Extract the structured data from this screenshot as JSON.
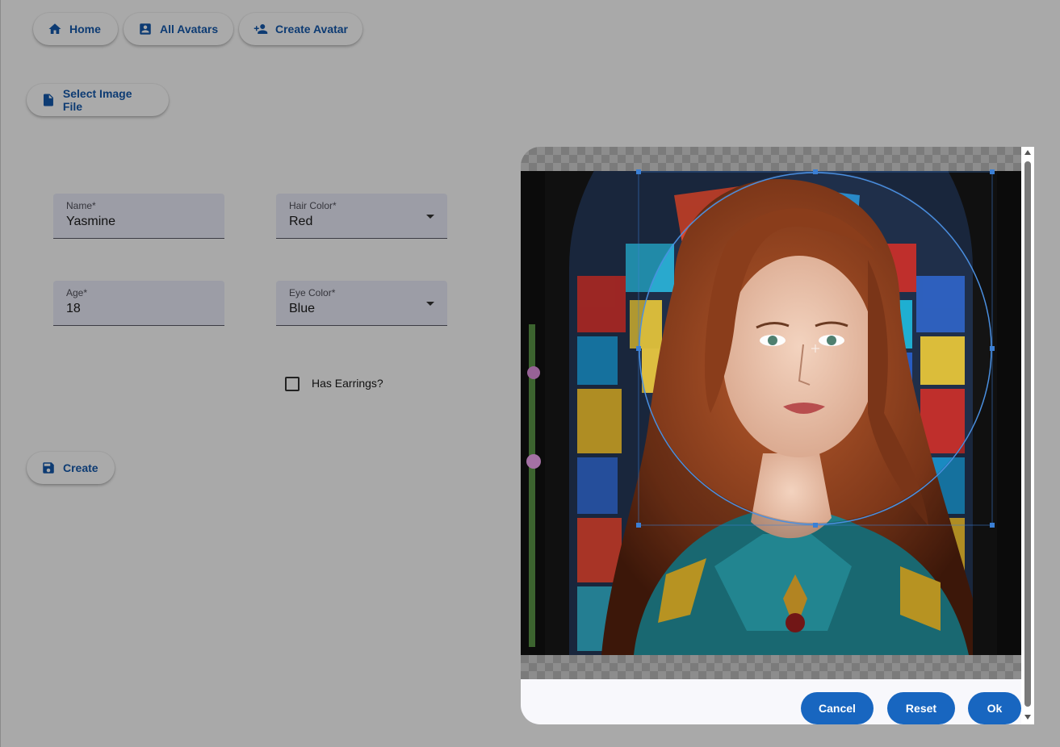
{
  "nav": {
    "home": "Home",
    "all_avatars": "All Avatars",
    "create_avatar": "Create Avatar"
  },
  "select_file_label": "Select Image File",
  "form": {
    "name": {
      "label": "Name*",
      "value": "Yasmine"
    },
    "hair_color": {
      "label": "Hair Color*",
      "value": "Red"
    },
    "age": {
      "label": "Age*",
      "value": "18"
    },
    "eye_color": {
      "label": "Eye Color*",
      "value": "Blue"
    },
    "has_earrings": {
      "label": "Has Earrings?",
      "checked": false
    }
  },
  "create_label": "Create",
  "cropper": {
    "cancel": "Cancel",
    "reset": "Reset",
    "ok": "Ok"
  },
  "colors": {
    "accent": "#1866c0",
    "nav_text": "#0d3b73",
    "background": "#a9a9a9"
  }
}
